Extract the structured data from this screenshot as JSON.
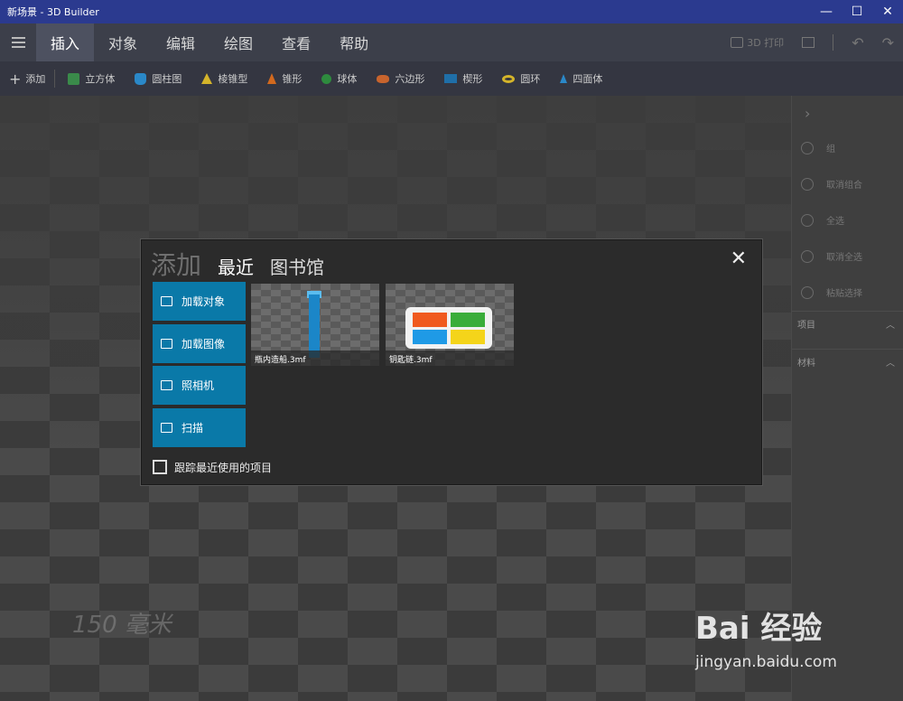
{
  "window": {
    "title": "新场景 - 3D Builder",
    "minimize": "—",
    "maximize": "☐",
    "close": "✕"
  },
  "menu": {
    "tabs": [
      "插入",
      "对象",
      "编辑",
      "绘图",
      "查看",
      "帮助"
    ],
    "print_label": "3D 打印"
  },
  "toolbar": {
    "add_label": "添加",
    "shapes": [
      "立方体",
      "圆柱图",
      "棱锥型",
      "锥形",
      "球体",
      "六边形",
      "楔形",
      "圆环",
      "四面体"
    ]
  },
  "viewport": {
    "scale_label": "150 毫米"
  },
  "right_panel": {
    "items": [
      "组",
      "取消组合",
      "全选",
      "取消全选",
      "粘贴选择"
    ],
    "sections": [
      "项目",
      "材料"
    ]
  },
  "dialog": {
    "tabs": [
      "添加",
      "最近",
      "图书馆"
    ],
    "active_tab": "最近",
    "actions": [
      "加载对象",
      "加载图像",
      "照相机",
      "扫描"
    ],
    "recent_files": [
      "瓶内造船.3mf",
      "钥匙链.3mf"
    ],
    "track_recent_label": "跟踪最近使用的项目",
    "close": "✕"
  },
  "watermark": {
    "main": "Bai 经验",
    "sub": "jingyan.baidu.com"
  },
  "colors": {
    "titlebar": "#2b3a8f",
    "accent": "#0a79a8"
  }
}
